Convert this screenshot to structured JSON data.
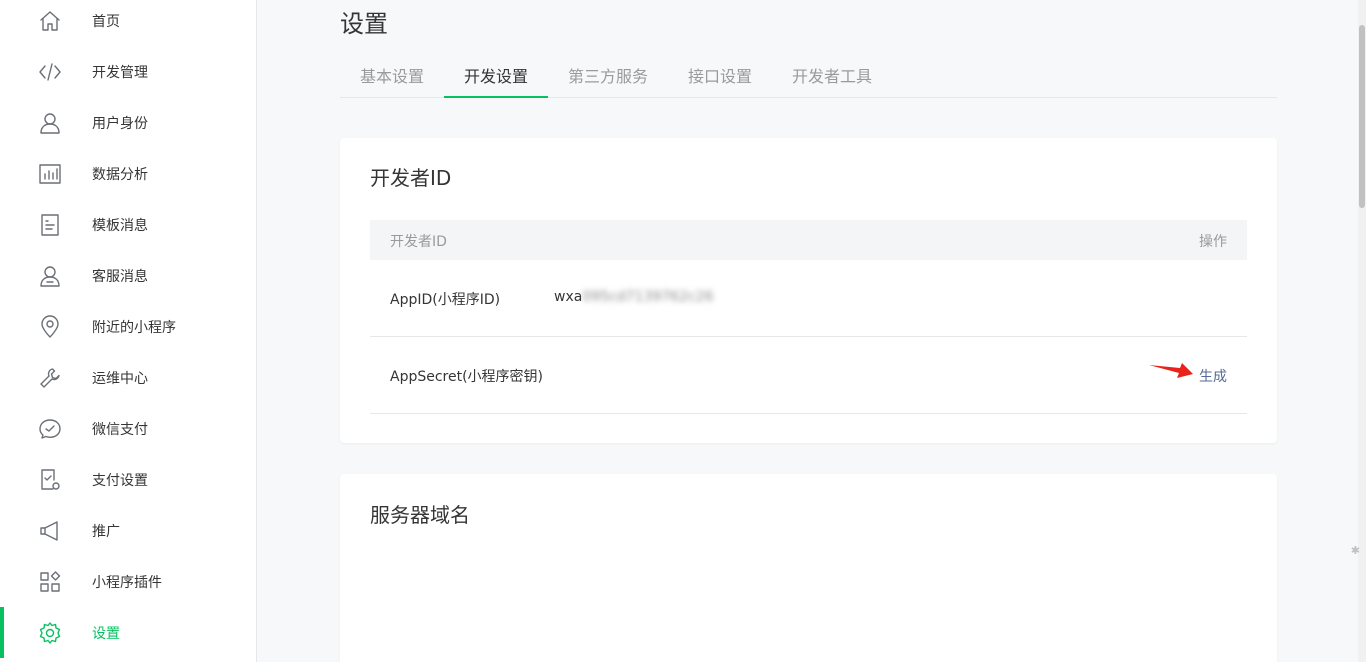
{
  "sidebar": {
    "items": [
      {
        "label": "首页",
        "icon": "home-icon"
      },
      {
        "label": "开发管理",
        "icon": "code-icon"
      },
      {
        "label": "用户身份",
        "icon": "user-icon"
      },
      {
        "label": "数据分析",
        "icon": "chart-icon"
      },
      {
        "label": "模板消息",
        "icon": "document-icon"
      },
      {
        "label": "客服消息",
        "icon": "customer-service-icon"
      },
      {
        "label": "附近的小程序",
        "icon": "location-pin-icon"
      },
      {
        "label": "运维中心",
        "icon": "wrench-icon"
      },
      {
        "label": "微信支付",
        "icon": "chat-check-icon"
      },
      {
        "label": "支付设置",
        "icon": "phone-settings-icon"
      },
      {
        "label": "推广",
        "icon": "megaphone-icon"
      },
      {
        "label": "小程序插件",
        "icon": "plugin-grid-icon"
      },
      {
        "label": "设置",
        "icon": "gear-icon"
      }
    ],
    "active_index": 12
  },
  "page": {
    "title": "设置"
  },
  "tabs": [
    {
      "label": "基本设置"
    },
    {
      "label": "开发设置"
    },
    {
      "label": "第三方服务"
    },
    {
      "label": "接口设置"
    },
    {
      "label": "开发者工具"
    }
  ],
  "developer_id": {
    "title": "开发者ID",
    "col_name": "开发者ID",
    "col_action": "操作",
    "rows": [
      {
        "name": "AppID(小程序ID)",
        "value_prefix": "wxa",
        "value_blurred": "095cd7139762c26",
        "action": ""
      },
      {
        "name": "AppSecret(小程序密钥)",
        "value_prefix": "",
        "value_blurred": "",
        "action": "生成"
      }
    ]
  },
  "server_domain": {
    "title": "服务器域名"
  },
  "colors": {
    "accent": "#07c160",
    "link": "#576b95",
    "arrow": "#e8231a"
  }
}
